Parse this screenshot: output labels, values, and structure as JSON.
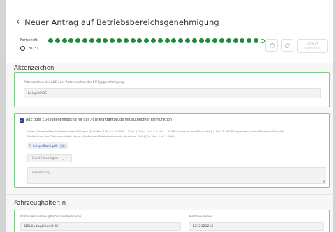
{
  "header": {
    "back_glyph": "‹",
    "title": "Neuer Antrag auf Betriebsbereichsgenehmigung",
    "progress_label": "Fortschritt",
    "progress_counter": "31/31",
    "progress_total_steps": 31,
    "progress_completed_steps": 31,
    "undo_icon": "undo-icon",
    "reload_icon": "reload-icon",
    "save_draft_label_line1": "Entwurf",
    "save_draft_label_line2": "speichern"
  },
  "aktenzeichen": {
    "section_title": "Aktenzeichen",
    "field_label": "Aktenzeichen der ABE oder Aktenzeichen der EU-Typgenehmigung",
    "field_value": "beispielABE"
  },
  "abe": {
    "checkbox_label": "ABE oder EU-Typgenehmigung für das / die Kraftfahrzeuge mit autonomer Fahrfunktion",
    "checkbox_checked": true,
    "description_line1": "Unter \"Aktenzeichen\" referenzierte ABE gem. § 1e Abs. 1 Nr 2 = 4 StVG i. V. m. § 2 Abs. 1 u. § 4 Abs. 1 AFGBV, sowie in den Fällen des § 4 Abs. 3 AFGBV ergänzend einen Nachweis über die",
    "description_line2": "Feststellung der Gleichwertigkeit der ausländischen Betriebserlaubnis durch das KBA (§ 1e Abs. 5 Nr 1 StVG).",
    "file_name": "beispielDatei.pdf",
    "add_documents_label": "Datei hinzufügen",
    "remark_placeholder": "Bemerkung"
  },
  "fahrzeughalter": {
    "section_title": "Fahrzeughalter:in",
    "name_label": "Name des Fahrzeughalters (Firmenname)",
    "name_value": "DEUlia Logistics OHG",
    "phone_label": "Telefonnummer",
    "phone_value": "1212121212"
  },
  "colors": {
    "accent_green": "#1f8a3b",
    "border_green": "#7ccb86",
    "checkbox_blue": "#2d3f8f"
  }
}
